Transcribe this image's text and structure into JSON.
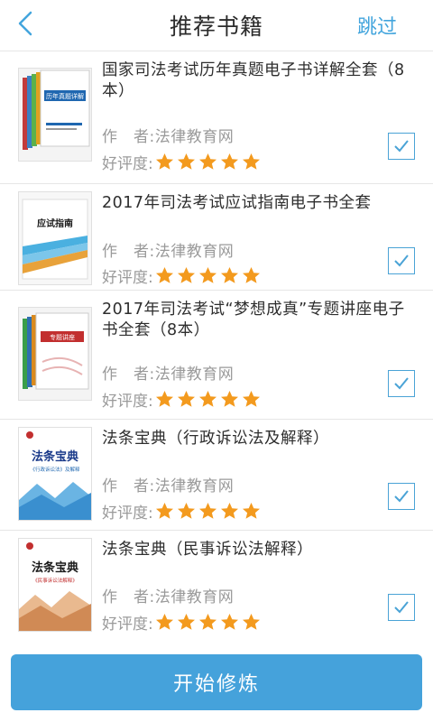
{
  "header": {
    "title": "推荐书籍",
    "skip_label": "跳过"
  },
  "accent_color": "#45a2db",
  "star_color": "#f39a1e",
  "books": [
    {
      "title": "国家司法考试历年真题电子书详解全套（8本）",
      "author": "作　者:法律教育网",
      "rating_label": "好评度:",
      "stars": 5,
      "checked": true,
      "cover_text": "历年真题详解"
    },
    {
      "title": "2017年司法考试应试指南电子书全套",
      "author": "作　者:法律教育网",
      "rating_label": "好评度:",
      "stars": 5,
      "checked": true,
      "cover_text": "应试指南"
    },
    {
      "title": "2017年司法考试“梦想成真”专题讲座电子书全套（8本）",
      "author": "作　者:法律教育网",
      "rating_label": "好评度:",
      "stars": 5,
      "checked": true,
      "cover_text": "专题讲座"
    },
    {
      "title": "法条宝典（行政诉讼法及解释）",
      "author": "作　者:法律教育网",
      "rating_label": "好评度:",
      "stars": 5,
      "checked": true,
      "cover_text": "法条宝典",
      "cover_sub": "《行政诉讼法》及解释"
    },
    {
      "title": "法条宝典（民事诉讼法解释）",
      "author": "作　者:法律教育网",
      "rating_label": "好评度:",
      "stars": 5,
      "checked": true,
      "cover_text": "法条宝典",
      "cover_sub": "《民事诉讼法解释》"
    }
  ],
  "footer": {
    "start_label": "开始修炼"
  }
}
